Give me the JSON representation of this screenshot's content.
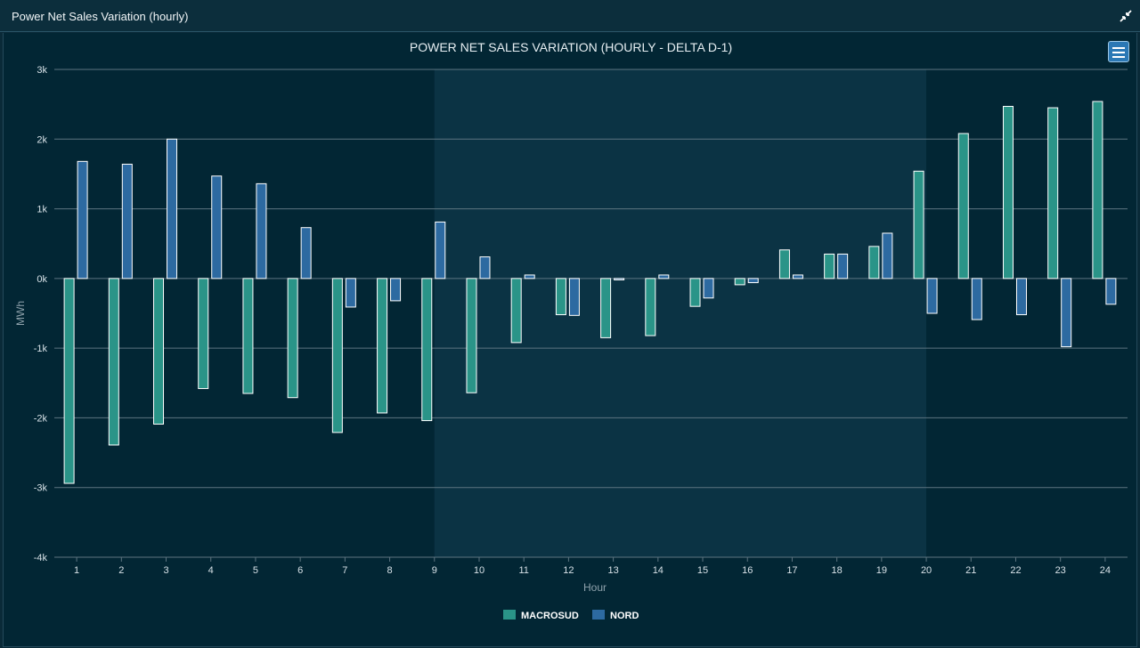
{
  "panel": {
    "title": "Power Net Sales Variation (hourly)",
    "collapse_icon": "collapse-arrows-icon",
    "menu_icon": "hamburger-menu-icon"
  },
  "colors": {
    "background": "#022634",
    "highlight_band": "#0b3344",
    "grid": "#5d7480",
    "axis_text": "#d8e2e8",
    "label_text": "#8fa2ac",
    "macrosud": "#2a9488",
    "nord": "#2d6aa1",
    "bar_border": "#ffffff"
  },
  "chart_data": {
    "type": "bar",
    "title": "POWER NET SALES VARIATION (HOURLY - DELTA D-1)",
    "xlabel": "Hour",
    "ylabel": "MWh",
    "categories": [
      "1",
      "2",
      "3",
      "4",
      "5",
      "6",
      "7",
      "8",
      "9",
      "10",
      "11",
      "12",
      "13",
      "14",
      "15",
      "16",
      "17",
      "18",
      "19",
      "20",
      "21",
      "22",
      "23",
      "24"
    ],
    "ylim": [
      -4000,
      3000
    ],
    "yticks": [
      3000,
      2000,
      1000,
      0,
      -1000,
      -2000,
      -3000,
      -4000
    ],
    "ytick_labels": [
      "3k",
      "2k",
      "1k",
      "0k",
      "-1k",
      "-2k",
      "-3k",
      "-4k"
    ],
    "highlight_band": [
      "9",
      "20"
    ],
    "grid": true,
    "legend_position": "bottom-center",
    "series": [
      {
        "name": "MACROSUD",
        "color": "#2a9488",
        "values": [
          -2940,
          -2390,
          -2090,
          -1580,
          -1650,
          -1710,
          -2210,
          -1930,
          -2040,
          -1640,
          -920,
          -520,
          -850,
          -820,
          -400,
          -90,
          410,
          350,
          460,
          1540,
          2080,
          2470,
          2450,
          2540
        ]
      },
      {
        "name": "NORD",
        "color": "#2d6aa1",
        "values": [
          1680,
          1640,
          2000,
          1470,
          1360,
          730,
          -410,
          -320,
          810,
          310,
          50,
          -530,
          -20,
          50,
          -280,
          -60,
          50,
          350,
          650,
          -500,
          -590,
          -520,
          -980,
          -370
        ]
      }
    ]
  }
}
